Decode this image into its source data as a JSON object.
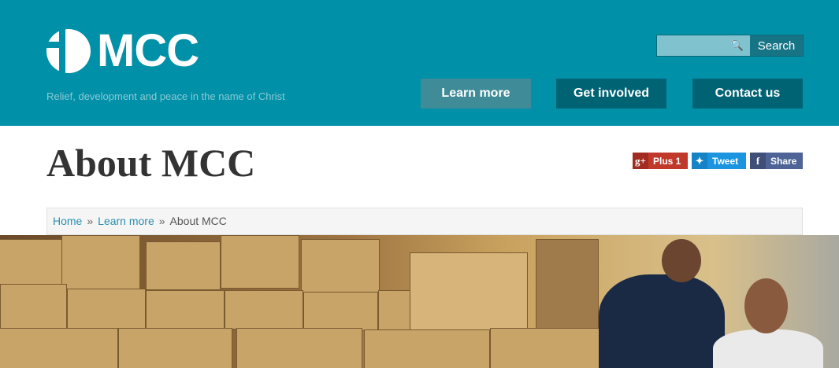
{
  "header": {
    "logo_text": "MCC",
    "tagline": "Relief, development and peace in the name of Christ",
    "search": {
      "placeholder": "",
      "button": "Search"
    },
    "nav": [
      "Learn more",
      "Get involved",
      "Contact us"
    ]
  },
  "page": {
    "title": "About MCC"
  },
  "share": {
    "gplus": "Plus 1",
    "twitter": "Tweet",
    "facebook": "Share"
  },
  "breadcrumb": [
    "Home",
    "Learn more",
    "About MCC"
  ],
  "breadcrumb_sep": "»",
  "colors": {
    "header": "#0090a8",
    "nav_active": "#3f8b97",
    "nav": "#006373",
    "gplus": "#c1392b",
    "twitter": "#1b95e0",
    "facebook": "#4f6496"
  }
}
